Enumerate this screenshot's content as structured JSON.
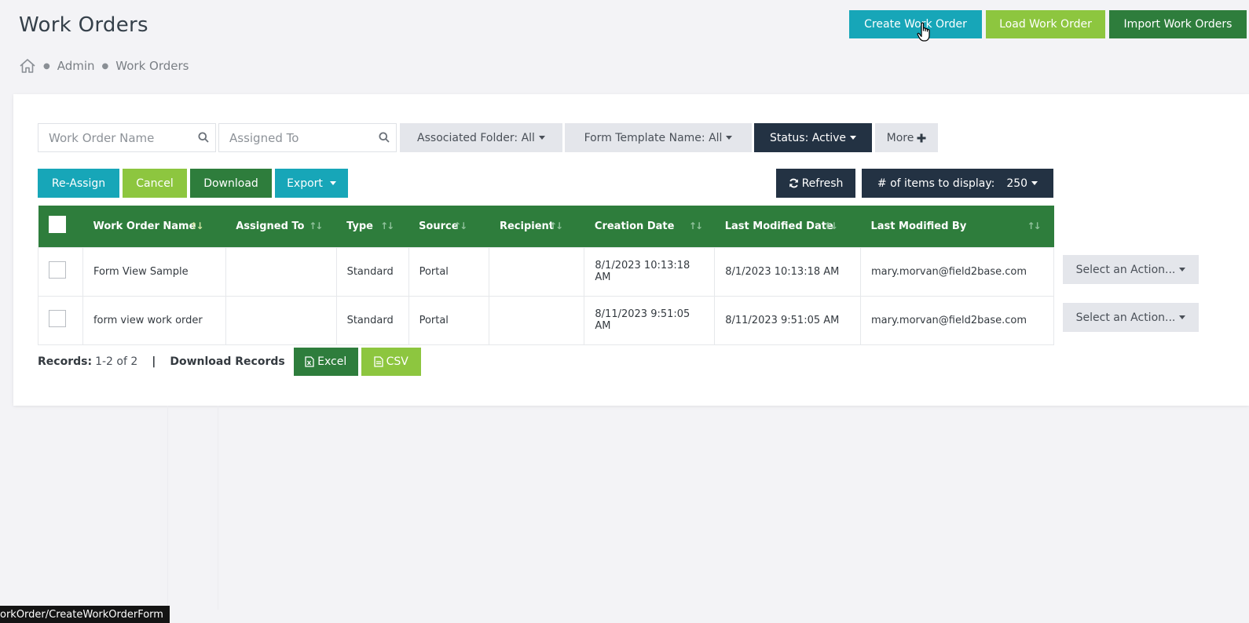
{
  "header": {
    "title": "Work Orders",
    "breadcrumb": [
      "Admin",
      "Work Orders"
    ],
    "create_label": "Create Work Order",
    "load_label": "Load Work Order",
    "import_label": "Import Work Orders"
  },
  "filters": {
    "name_placeholder": "Work Order Name",
    "assigned_placeholder": "Assigned To",
    "folder_label": "Associated Folder: All",
    "template_label": "Form Template Name: All",
    "status_label": "Status: Active",
    "more_label": "More"
  },
  "toolbar": {
    "reassign_label": "Re-Assign",
    "cancel_label": "Cancel",
    "download_label": "Download",
    "export_label": "Export",
    "refresh_label": "Refresh",
    "items_label": "# of items to display:",
    "items_value": "250"
  },
  "table": {
    "columns": [
      "Work Order Name",
      "Assigned To",
      "Type",
      "Source",
      "Recipient",
      "Creation Date",
      "Last Modified Date",
      "Last Modified By"
    ],
    "rows": [
      {
        "name": "Form View Sample",
        "assigned": "",
        "type": "Standard",
        "source": "Portal",
        "recipient": "",
        "created": "8/1/2023 10:13:18 AM",
        "modified": "8/1/2023 10:13:18 AM",
        "modified_by": "mary.morvan@field2base.com",
        "action": "Select an Action..."
      },
      {
        "name": "form view work order",
        "assigned": "",
        "type": "Standard",
        "source": "Portal",
        "recipient": "",
        "created": "8/11/2023 9:51:05 AM",
        "modified": "8/11/2023 9:51:05 AM",
        "modified_by": "mary.morvan@field2base.com",
        "action": "Select an Action..."
      }
    ]
  },
  "footer": {
    "records_label": "Records:",
    "records_value": "1-2 of 2",
    "divider": "|",
    "download_records_label": "Download Records",
    "excel_label": "Excel",
    "csv_label": "CSV"
  },
  "status_bar": {
    "url": "orkOrder/CreateWorkOrderForm"
  },
  "colors": {
    "teal": "#17a6b8",
    "lime": "#8dc63f",
    "dark_green": "#2e7d3c",
    "navy": "#233243",
    "header_green": "#2e7d3c"
  }
}
